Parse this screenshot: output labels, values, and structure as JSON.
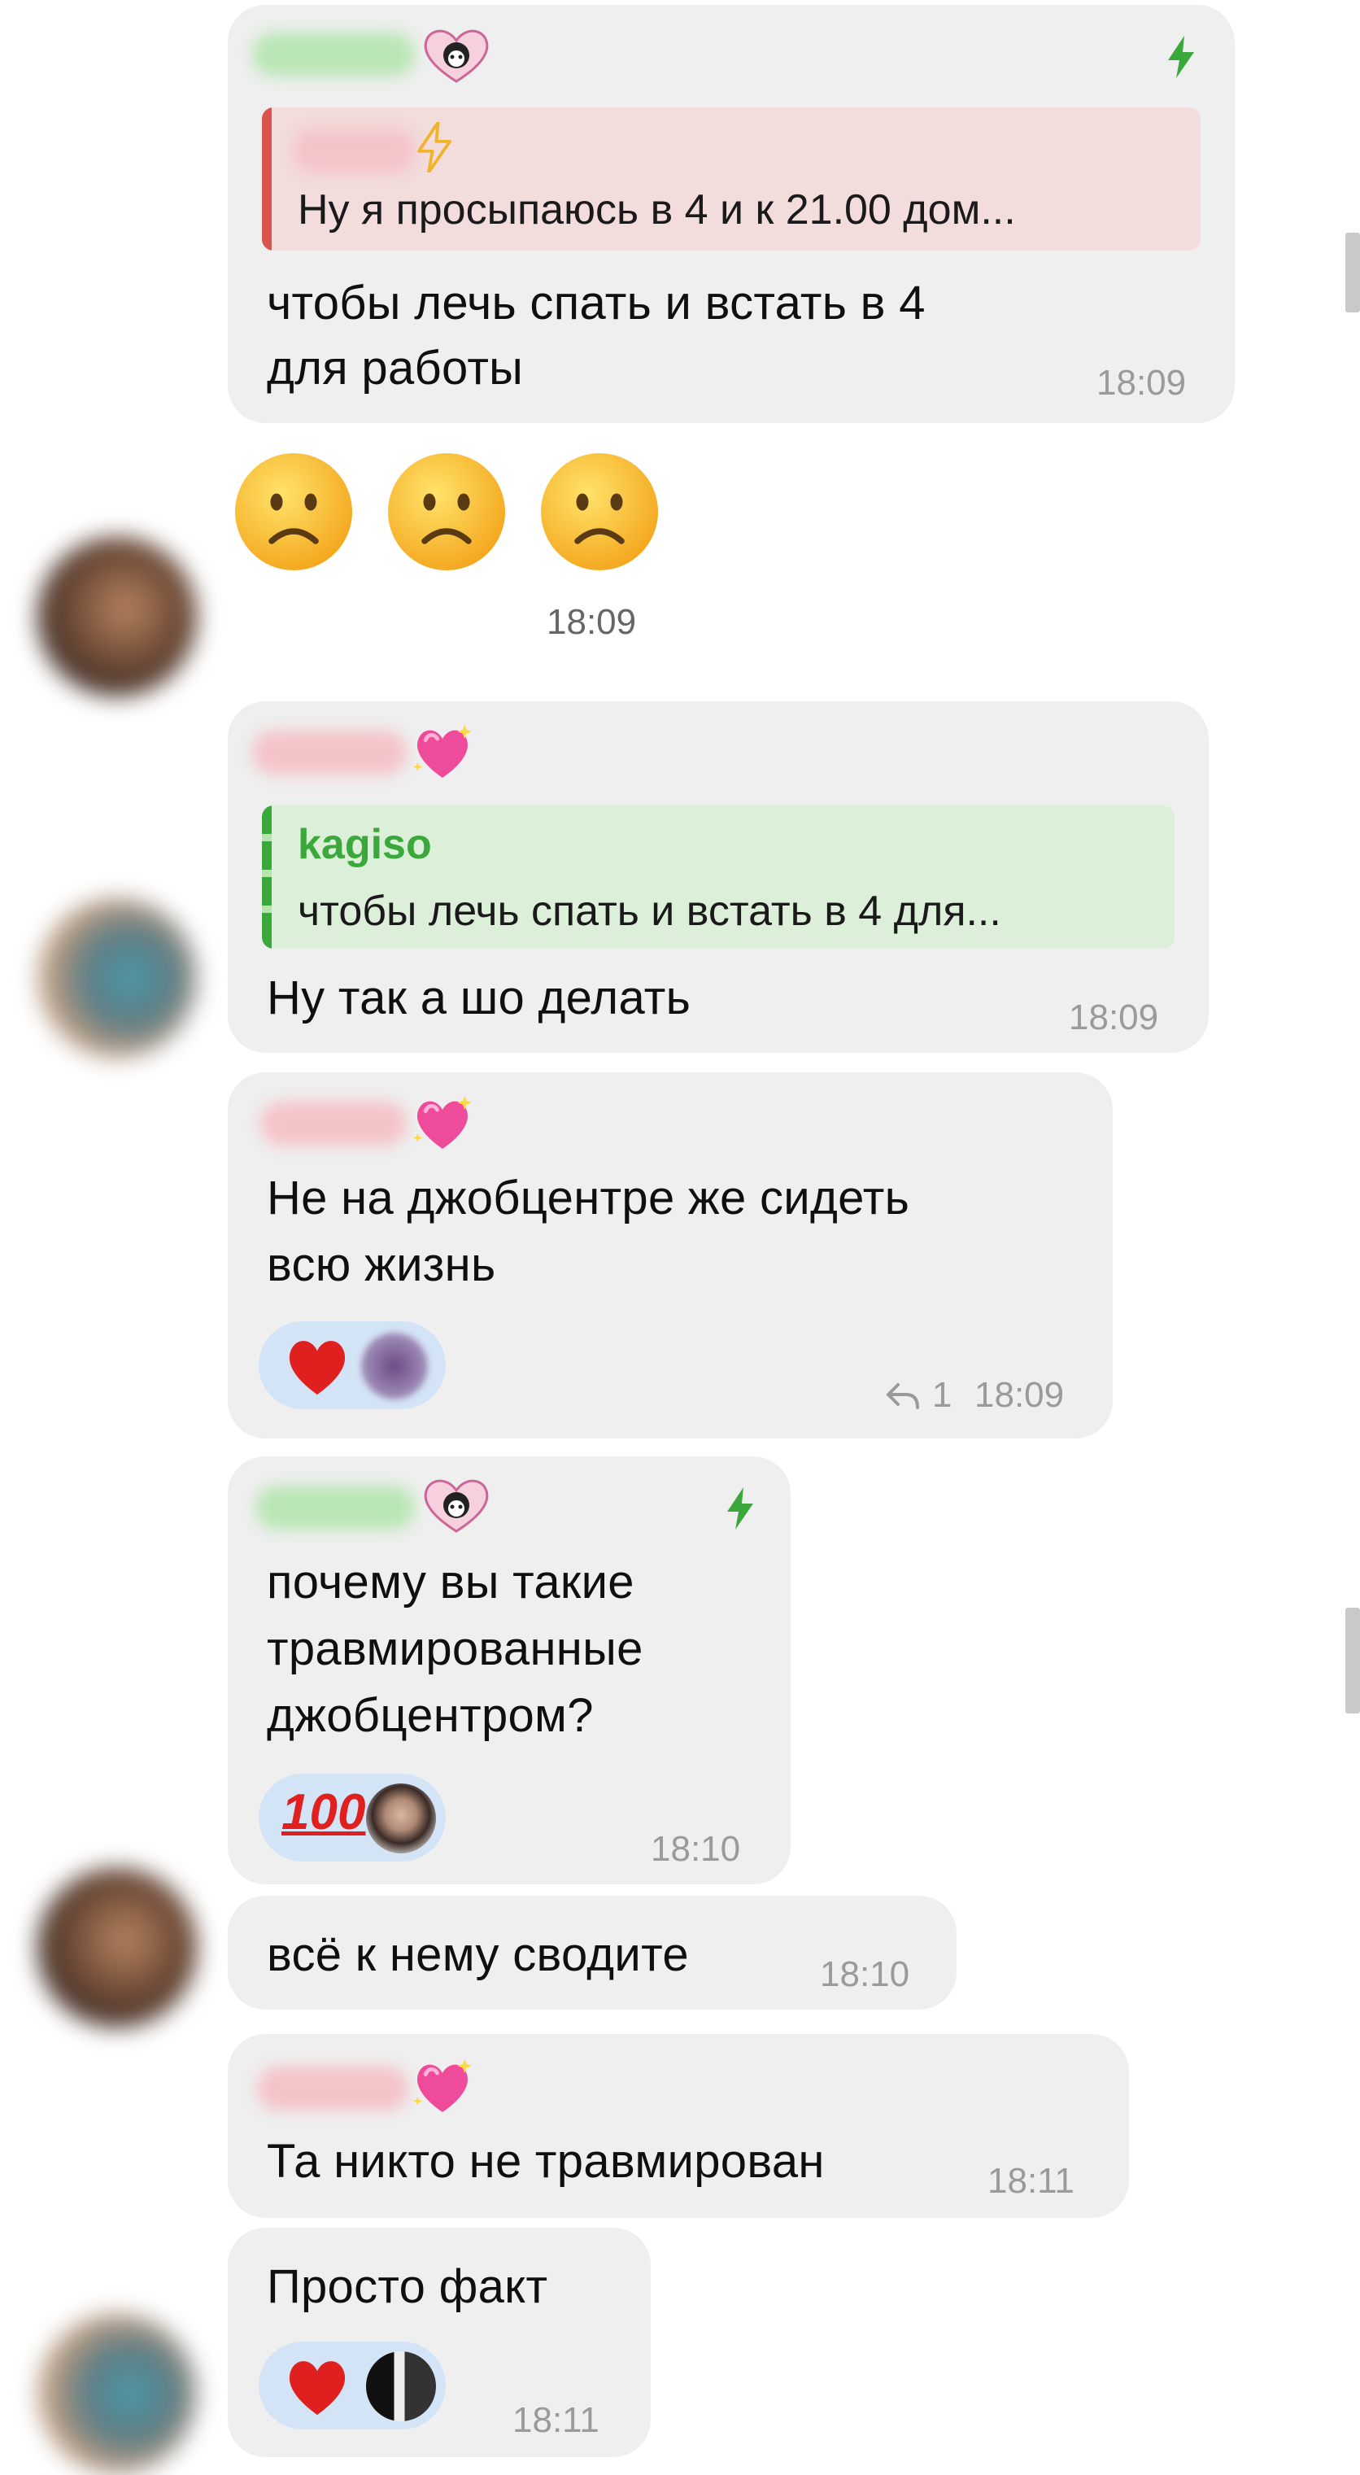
{
  "messages": [
    {
      "id": "m1",
      "quote_text": "Ну я просыпаюсь  в 4 и к 21.00 дом...",
      "text_line1": "чтобы лечь спать и встать в 4",
      "text_line2": "для работы",
      "time": "18:09"
    },
    {
      "id": "m2",
      "emojis": [
        "frowning-face",
        "frowning-face",
        "frowning-face"
      ],
      "time": "18:09"
    },
    {
      "id": "m3",
      "quote_author": "kagiso",
      "quote_text": "чтобы лечь спать и встать в 4 для...",
      "text": "Ну так а шо делать",
      "time": "18:09"
    },
    {
      "id": "m4",
      "text_line1": "Не на джобцентре же сидеть",
      "text_line2": "всю жизнь",
      "reaction": "heart",
      "reply_count": "1",
      "time": "18:09"
    },
    {
      "id": "m5",
      "text_line1": "почему вы такие",
      "text_line2": "травмированные",
      "text_line3": "джобцентром?",
      "reaction_text": "100",
      "time": "18:10"
    },
    {
      "id": "m6",
      "text": "всё к нему сводите",
      "time": "18:10"
    },
    {
      "id": "m7",
      "text": "Та никто не травмирован",
      "time": "18:11"
    },
    {
      "id": "m8",
      "text": "Просто факт",
      "reaction": "heart",
      "time": "18:11"
    }
  ],
  "colors": {
    "bubble": "#efefef",
    "accent_green": "#3aa83a",
    "quote_red_bg": "#f3dcdc",
    "quote_red_bar": "#d9534f",
    "quote_green_bg": "#dcefd8",
    "reaction_bg": "#d4e4f7"
  }
}
